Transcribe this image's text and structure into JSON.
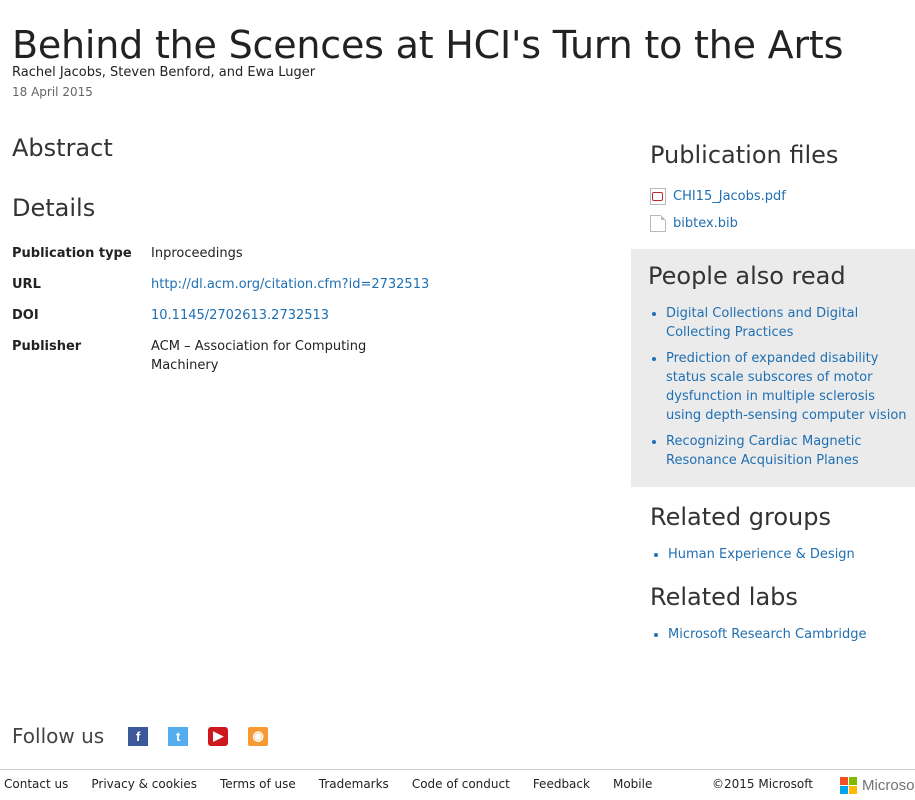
{
  "publication": {
    "title": "Behind the Scences at HCI's Turn to the Arts",
    "authors": "Rachel Jacobs, Steven Benford, and Ewa Luger",
    "date": "18 April 2015"
  },
  "sections": {
    "abstract": "Abstract",
    "details": "Details"
  },
  "details": [
    {
      "label": "Publication type",
      "value": "Inproceedings"
    },
    {
      "label": "URL",
      "value": "http://dl.acm.org/citation.cfm?id=2732513"
    },
    {
      "label": "DOI",
      "value": "10.1145/2702613.2732513"
    },
    {
      "label": "Publisher",
      "value": "ACM – Association for Computing Machinery"
    }
  ],
  "publication_files": {
    "heading": "Publication files",
    "files": [
      {
        "name": "CHI15_Jacobs.pdf",
        "icon": "pdf-icon"
      },
      {
        "name": "bibtex.bib",
        "icon": "document-icon"
      }
    ]
  },
  "people_also_read": {
    "heading": "People also read",
    "items": [
      "Digital Collections and Digital Collecting Practices",
      "Prediction of expanded disability status scale subscores of motor dysfunction in multiple sclerosis using depth-sensing computer vision",
      "Recognizing Cardiac Magnetic Resonance Acquisition Planes"
    ]
  },
  "related_groups": {
    "heading": "Related groups",
    "items": [
      "Human Experience & Design"
    ]
  },
  "related_labs": {
    "heading": "Related labs",
    "items": [
      "Microsoft Research Cambridge"
    ]
  },
  "follow": {
    "label": "Follow us",
    "icons": [
      "facebook-icon",
      "twitter-icon",
      "youtube-icon",
      "rss-icon"
    ]
  },
  "footer": {
    "links": [
      "Contact us",
      "Privacy & cookies",
      "Terms of use",
      "Trademarks",
      "Code of conduct",
      "Feedback",
      "Mobile"
    ],
    "copyright": "©2015 Microsoft",
    "logo_text": "Microsoft"
  },
  "colors": {
    "link": "#1f6fb2",
    "panel": "#ebebeb"
  }
}
